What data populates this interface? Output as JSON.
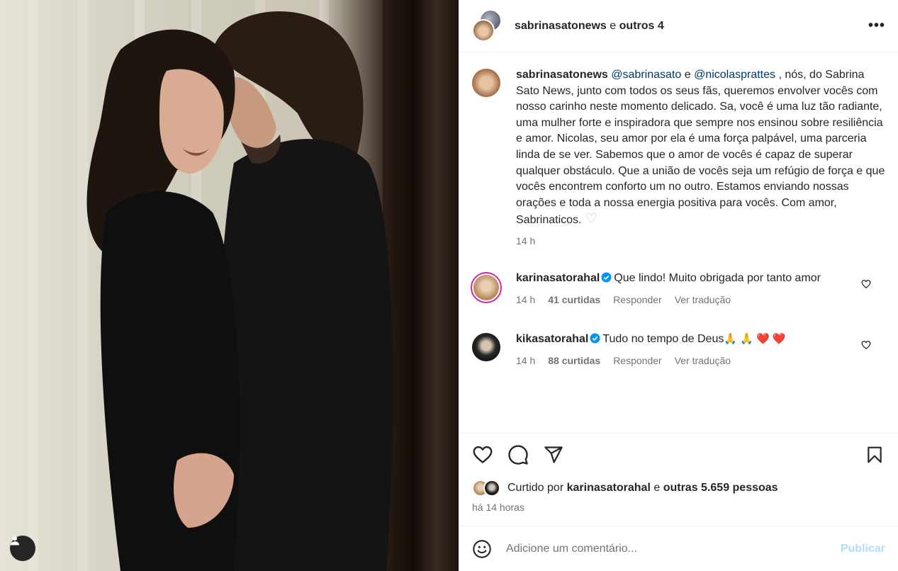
{
  "header": {
    "username": "sabrinasatonews",
    "connector": "e",
    "others": "outros 4",
    "more_label": "•••"
  },
  "caption": {
    "username": "sabrinasatonews",
    "mention1": "@sabrinasato",
    "connector": "e",
    "mention2": "@nicolasprattes",
    "text": " , nós, do Sabrina Sato News, junto com todos os seus fãs, queremos envolver vocês com nosso carinho neste momento delicado. Sa, você é uma luz tão radiante, uma mulher forte e inspiradora que sempre nos ensinou sobre resiliência e amor. Nicolas, seu amor por ela é uma força palpável, uma parceria linda de se ver. Sabemos que o amor de vocês é capaz de superar qualquer obstáculo. Que a união de vocês seja um refúgio de força e que vocês encontrem conforto um no outro. Estamos enviando nossas orações e toda a nossa energia positiva para vocês. Com amor, Sabrinaticos. ",
    "emoji": "♡",
    "time": "14 h"
  },
  "comments": [
    {
      "username": "karinasatorahal",
      "text": "Que lindo! Muito obrigada por tanto amor",
      "time": "14 h",
      "likes": "41 curtidas",
      "reply": "Responder",
      "translate": "Ver tradução"
    },
    {
      "username": "kikasatorahal",
      "text": "Tudo no tempo de Deus",
      "emojis": "🙏 🙏 ❤️ ❤️",
      "time": "14 h",
      "likes": "88 curtidas",
      "reply": "Responder",
      "translate": "Ver tradução"
    }
  ],
  "likes": {
    "prefix": "Curtido por",
    "user": "karinasatorahal",
    "connector": "e",
    "others": "outras 5.659 pessoas"
  },
  "posted": "há 14 horas",
  "comment_box": {
    "placeholder": "Adicione um comentário...",
    "publish_label": "Publicar"
  },
  "icons": [
    "heart-icon",
    "comment-icon",
    "share-icon",
    "bookmark-icon",
    "emoji-icon",
    "user-tag-icon",
    "verified-icon"
  ],
  "colors": {
    "link": "#00376b",
    "muted": "#737373",
    "publish_disabled": "#b3dbff",
    "verified": "#0095f6"
  }
}
